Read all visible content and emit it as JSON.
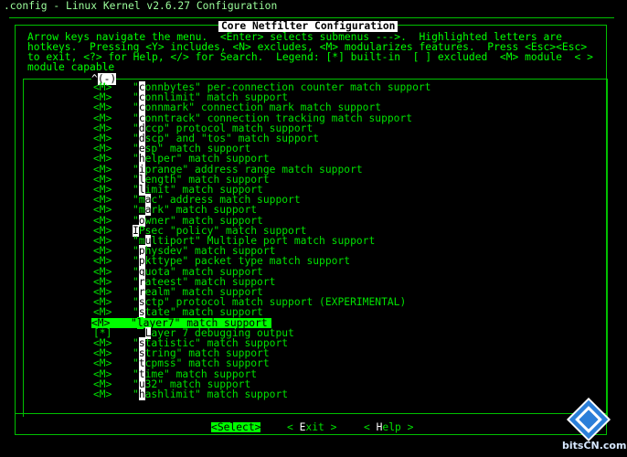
{
  "window": {
    "title": ".config - Linux Kernel v2.6.27 Configuration"
  },
  "dialog": {
    "title": "Core Netfilter Configuration",
    "help_lines": [
      "Arrow keys navigate the menu.  <Enter> selects submenus --->.  Highlighted letters are",
      "hotkeys.  Pressing <Y> includes, <N> excludes, <M> modularizes features.  Press <Esc><Esc>",
      "to exit, <?> for Help, </> for Search.  Legend: [*] built-in  [ ] excluded  <M> module  < >",
      "module capable"
    ],
    "scroll_up_indicator": {
      "prefix": "^",
      "mark": "(-)"
    }
  },
  "items": [
    {
      "tag": "<M>",
      "pre": "\"",
      "hotkey": "c",
      "rest": "onnbytes\" per-connection counter match support"
    },
    {
      "tag": "<M>",
      "pre": "\"",
      "hotkey": "c",
      "rest": "onnlimit\" match support"
    },
    {
      "tag": "<M>",
      "pre": "\"",
      "hotkey": "c",
      "rest": "onnmark\" connection mark match support"
    },
    {
      "tag": "<M>",
      "pre": "\"",
      "hotkey": "c",
      "rest": "onntrack\" connection tracking match support"
    },
    {
      "tag": "<M>",
      "pre": "\"",
      "hotkey": "d",
      "rest": "ccp\" protocol match support"
    },
    {
      "tag": "<M>",
      "pre": "\"",
      "hotkey": "d",
      "rest": "scp\" and \"tos\" match support"
    },
    {
      "tag": "<M>",
      "pre": "\"",
      "hotkey": "e",
      "rest": "sp\" match support"
    },
    {
      "tag": "<M>",
      "pre": "\"",
      "hotkey": "h",
      "rest": "elper\" match support"
    },
    {
      "tag": "<M>",
      "pre": "\"",
      "hotkey": "i",
      "rest": "prange\" address range match support"
    },
    {
      "tag": "<M>",
      "pre": "\"",
      "hotkey": "l",
      "rest": "ength\" match support"
    },
    {
      "tag": "<M>",
      "pre": "\"",
      "hotkey": "l",
      "rest": "imit\" match support"
    },
    {
      "tag": "<M>",
      "pre": "\"m",
      "hotkey": "a",
      "rest": "c\" address match support"
    },
    {
      "tag": "<M>",
      "pre": "\"m",
      "hotkey": "a",
      "rest": "rk\" match support"
    },
    {
      "tag": "<M>",
      "pre": "\"",
      "hotkey": "o",
      "rest": "wner\" match support"
    },
    {
      "tag": "<M>",
      "pre": "",
      "hotkey": "I",
      "rest": "Psec \"policy\" match support"
    },
    {
      "tag": "<M>",
      "pre": "\"m",
      "hotkey": "u",
      "rest": "ltiport\" Multiple port match support"
    },
    {
      "tag": "<M>",
      "pre": "\"",
      "hotkey": "p",
      "rest": "hysdev\" match support"
    },
    {
      "tag": "<M>",
      "pre": "\"",
      "hotkey": "p",
      "rest": "kttype\" packet type match support"
    },
    {
      "tag": "<M>",
      "pre": "\"",
      "hotkey": "q",
      "rest": "uota\" match support"
    },
    {
      "tag": "<M>",
      "pre": "\"",
      "hotkey": "r",
      "rest": "ateest\" match support"
    },
    {
      "tag": "<M>",
      "pre": "\"",
      "hotkey": "r",
      "rest": "ealm\" match support"
    },
    {
      "tag": "<M>",
      "pre": "\"",
      "hotkey": "s",
      "rest": "ctp\" protocol match support (EXPERIMENTAL)"
    },
    {
      "tag": "<M>",
      "pre": "\"",
      "hotkey": "s",
      "rest": "tate\" match support"
    },
    {
      "tag": "<M>",
      "pre": "\"",
      "hotkey": "l",
      "rest": "ayer7\" match support",
      "selected": true
    },
    {
      "tag": "[*]",
      "pre": "  ",
      "hotkey": "L",
      "rest": "ayer 7 debugging output"
    },
    {
      "tag": "<M>",
      "pre": "\"",
      "hotkey": "s",
      "rest": "tatistic\" match support"
    },
    {
      "tag": "<M>",
      "pre": "\"",
      "hotkey": "s",
      "rest": "tring\" match support"
    },
    {
      "tag": "<M>",
      "pre": "\"",
      "hotkey": "t",
      "rest": "cpmss\" match support"
    },
    {
      "tag": "<M>",
      "pre": "\"",
      "hotkey": "t",
      "rest": "ime\" match support"
    },
    {
      "tag": "<M>",
      "pre": "\"",
      "hotkey": "u",
      "rest": "32\" match support"
    },
    {
      "tag": "<M>",
      "pre": "\"",
      "hotkey": "h",
      "rest": "ashlimit\" match support"
    }
  ],
  "buttons": {
    "select": {
      "open": "<",
      "key": "S",
      "rest": "elect",
      "close": ">"
    },
    "exit": {
      "open": "< ",
      "key": "E",
      "rest": "xit",
      "close": " >"
    },
    "help": {
      "open": "< ",
      "key": "H",
      "rest": "elp",
      "close": " >"
    }
  },
  "watermark": {
    "text": "bitsCN.com",
    "colors": [
      "#4aa3ff",
      "#ffffff"
    ]
  }
}
